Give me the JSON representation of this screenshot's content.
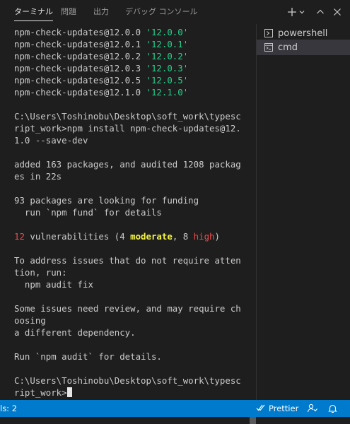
{
  "tabs": [
    {
      "label": "ターミナル",
      "active": true
    },
    {
      "label": "問題"
    },
    {
      "label": "出力"
    },
    {
      "label": "デバッグ コンソール"
    }
  ],
  "actions": [
    "plus-icon",
    "chevron-down-icon",
    "chevron-up-icon",
    "close-icon"
  ],
  "terminal": {
    "lines": [
      [
        {
          "t": "npm-check-updates@12.0.0 "
        },
        {
          "t": "'12.0.0'",
          "c": "g"
        }
      ],
      [
        {
          "t": "npm-check-updates@12.0.1 "
        },
        {
          "t": "'12.0.1'",
          "c": "g"
        }
      ],
      [
        {
          "t": "npm-check-updates@12.0.2 "
        },
        {
          "t": "'12.0.2'",
          "c": "g"
        }
      ],
      [
        {
          "t": "npm-check-updates@12.0.3 "
        },
        {
          "t": "'12.0.3'",
          "c": "g"
        }
      ],
      [
        {
          "t": "npm-check-updates@12.0.5 "
        },
        {
          "t": "'12.0.5'",
          "c": "g"
        }
      ],
      [
        {
          "t": "npm-check-updates@12.1.0 "
        },
        {
          "t": "'12.1.0'",
          "c": "g"
        }
      ],
      [],
      [
        {
          "t": "C:\\Users\\Toshinobu\\Desktop\\soft_work\\typescript_work>npm install npm-check-updates@12.1.0 --save-dev"
        }
      ],
      [],
      [
        {
          "t": "added 163 packages, and audited 1208 packages in 22s"
        }
      ],
      [],
      [
        {
          "t": "93 packages are looking for funding"
        }
      ],
      [
        {
          "t": "  run `npm fund` for details"
        }
      ],
      [],
      [
        {
          "t": "12",
          "c": "r"
        },
        {
          "t": " vulnerabilities (4 "
        },
        {
          "t": "moderate",
          "c": "y"
        },
        {
          "t": ", 8 "
        },
        {
          "t": "high",
          "c": "r"
        },
        {
          "t": ")"
        }
      ],
      [],
      [
        {
          "t": "To address issues that do not require attention, run:"
        }
      ],
      [
        {
          "t": "  npm audit fix"
        }
      ],
      [],
      [
        {
          "t": "Some issues need review, and may require choosing"
        }
      ],
      [
        {
          "t": "a different dependency."
        }
      ],
      [],
      [
        {
          "t": "Run `npm audit` for details."
        }
      ],
      [],
      [
        {
          "t": "C:\\Users\\Toshinobu\\Desktop\\soft_work\\typescript_work>"
        }
      ]
    ]
  },
  "terminals_list": [
    {
      "label": "powershell",
      "icon": "powershell-icon",
      "active": false
    },
    {
      "label": "cmd",
      "icon": "cmd-icon",
      "active": true
    }
  ],
  "statusbar": {
    "left_text": "ls: 2",
    "prettier_label": "Prettier",
    "icons": [
      "double-check-icon",
      "feedback-icon",
      "bell-icon"
    ]
  }
}
